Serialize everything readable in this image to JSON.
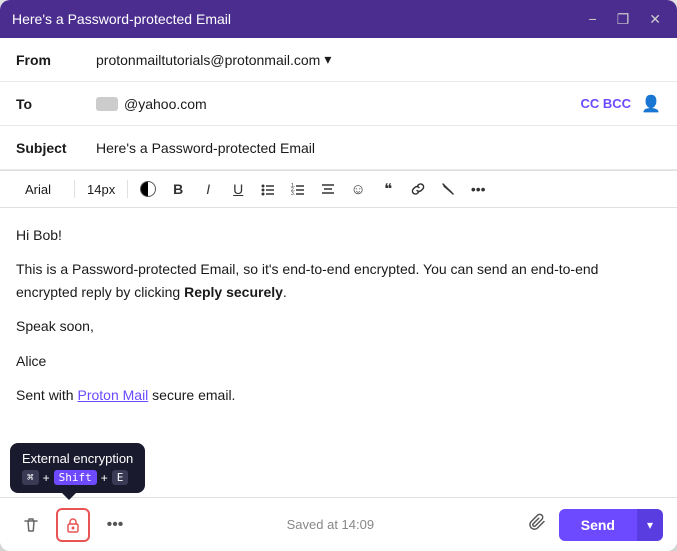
{
  "window": {
    "title": "Here's a Password-protected Email",
    "controls": {
      "minimize": "−",
      "restore": "❐",
      "close": "✕"
    }
  },
  "from": {
    "label": "From",
    "email": "protonmailtutorials@protonmail.com",
    "dropdown_arrow": "▾"
  },
  "to": {
    "label": "To",
    "email": "@yahoo.com",
    "cc_bcc": "CC BCC"
  },
  "subject": {
    "label": "Subject",
    "value": "Here's a Password-protected Email"
  },
  "toolbar": {
    "font": "Arial",
    "size": "14px",
    "bold": "B",
    "italic": "I",
    "underline": "U",
    "bullet_list": "☰",
    "ordered_list": "≡",
    "align": "≡",
    "emoji": "☺",
    "quote": "❝",
    "link": "🔗",
    "clear": "⌫",
    "more": "•••"
  },
  "body": {
    "greeting": "Hi Bob!",
    "paragraph1": "This is a Password-protected Email, so it's end-to-end encrypted. You can send an end-to-end encrypted reply by clicking ",
    "reply_securely": "Reply securely",
    "paragraph1_end": ".",
    "sign_off": "Speak soon,",
    "name": "Alice",
    "footer_prefix": "Sent with ",
    "footer_link": "Proton Mail",
    "footer_suffix": " secure email."
  },
  "bottom_bar": {
    "delete_icon": "🗑",
    "lock_icon": "🔒",
    "more_icon": "•••",
    "saved_at": "Saved at 14:09",
    "attachment_icon": "📎",
    "send_label": "Send",
    "send_dropdown": "▾"
  },
  "tooltip": {
    "title": "External encryption",
    "key1": "⌘",
    "key2": "Shift",
    "key3": "E"
  }
}
